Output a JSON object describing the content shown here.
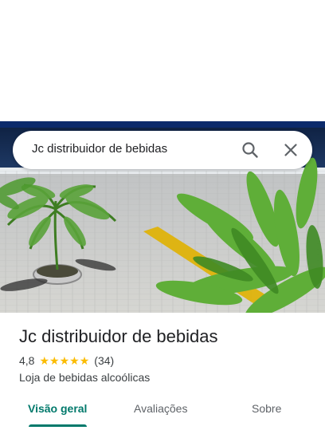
{
  "search": {
    "query": "Jc distribuidor de bebidas",
    "search_icon": "search-icon",
    "close_icon": "close-icon"
  },
  "place": {
    "name": "Jc distribuidor de bebidas",
    "rating": "4,8",
    "rating_value": 4.8,
    "stars_max": 5,
    "reviews": "(34)",
    "category": "Loja de bebidas alcoólicas"
  },
  "tabs": [
    {
      "label": "Visão geral",
      "active": true
    },
    {
      "label": "Avaliações",
      "active": false
    },
    {
      "label": "Sobre",
      "active": false
    }
  ],
  "colors": {
    "accent": "#00796b",
    "star": "#fbbc04",
    "text": "#202124"
  }
}
